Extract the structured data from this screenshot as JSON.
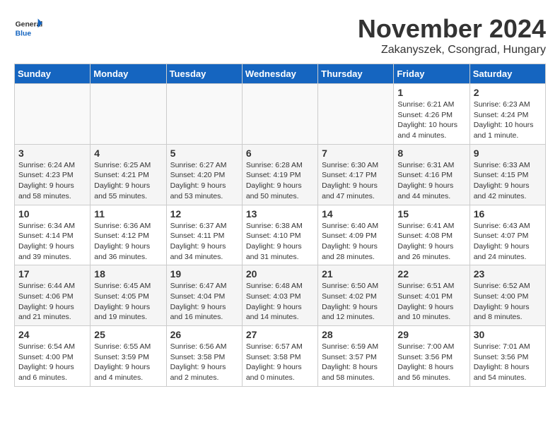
{
  "header": {
    "logo_general": "General",
    "logo_blue": "Blue",
    "month_title": "November 2024",
    "location": "Zakanyszek, Csongrad, Hungary"
  },
  "weekdays": [
    "Sunday",
    "Monday",
    "Tuesday",
    "Wednesday",
    "Thursday",
    "Friday",
    "Saturday"
  ],
  "weeks": [
    [
      {
        "day": "",
        "info": ""
      },
      {
        "day": "",
        "info": ""
      },
      {
        "day": "",
        "info": ""
      },
      {
        "day": "",
        "info": ""
      },
      {
        "day": "",
        "info": ""
      },
      {
        "day": "1",
        "info": "Sunrise: 6:21 AM\nSunset: 4:26 PM\nDaylight: 10 hours\nand 4 minutes."
      },
      {
        "day": "2",
        "info": "Sunrise: 6:23 AM\nSunset: 4:24 PM\nDaylight: 10 hours\nand 1 minute."
      }
    ],
    [
      {
        "day": "3",
        "info": "Sunrise: 6:24 AM\nSunset: 4:23 PM\nDaylight: 9 hours\nand 58 minutes."
      },
      {
        "day": "4",
        "info": "Sunrise: 6:25 AM\nSunset: 4:21 PM\nDaylight: 9 hours\nand 55 minutes."
      },
      {
        "day": "5",
        "info": "Sunrise: 6:27 AM\nSunset: 4:20 PM\nDaylight: 9 hours\nand 53 minutes."
      },
      {
        "day": "6",
        "info": "Sunrise: 6:28 AM\nSunset: 4:19 PM\nDaylight: 9 hours\nand 50 minutes."
      },
      {
        "day": "7",
        "info": "Sunrise: 6:30 AM\nSunset: 4:17 PM\nDaylight: 9 hours\nand 47 minutes."
      },
      {
        "day": "8",
        "info": "Sunrise: 6:31 AM\nSunset: 4:16 PM\nDaylight: 9 hours\nand 44 minutes."
      },
      {
        "day": "9",
        "info": "Sunrise: 6:33 AM\nSunset: 4:15 PM\nDaylight: 9 hours\nand 42 minutes."
      }
    ],
    [
      {
        "day": "10",
        "info": "Sunrise: 6:34 AM\nSunset: 4:14 PM\nDaylight: 9 hours\nand 39 minutes."
      },
      {
        "day": "11",
        "info": "Sunrise: 6:36 AM\nSunset: 4:12 PM\nDaylight: 9 hours\nand 36 minutes."
      },
      {
        "day": "12",
        "info": "Sunrise: 6:37 AM\nSunset: 4:11 PM\nDaylight: 9 hours\nand 34 minutes."
      },
      {
        "day": "13",
        "info": "Sunrise: 6:38 AM\nSunset: 4:10 PM\nDaylight: 9 hours\nand 31 minutes."
      },
      {
        "day": "14",
        "info": "Sunrise: 6:40 AM\nSunset: 4:09 PM\nDaylight: 9 hours\nand 28 minutes."
      },
      {
        "day": "15",
        "info": "Sunrise: 6:41 AM\nSunset: 4:08 PM\nDaylight: 9 hours\nand 26 minutes."
      },
      {
        "day": "16",
        "info": "Sunrise: 6:43 AM\nSunset: 4:07 PM\nDaylight: 9 hours\nand 24 minutes."
      }
    ],
    [
      {
        "day": "17",
        "info": "Sunrise: 6:44 AM\nSunset: 4:06 PM\nDaylight: 9 hours\nand 21 minutes."
      },
      {
        "day": "18",
        "info": "Sunrise: 6:45 AM\nSunset: 4:05 PM\nDaylight: 9 hours\nand 19 minutes."
      },
      {
        "day": "19",
        "info": "Sunrise: 6:47 AM\nSunset: 4:04 PM\nDaylight: 9 hours\nand 16 minutes."
      },
      {
        "day": "20",
        "info": "Sunrise: 6:48 AM\nSunset: 4:03 PM\nDaylight: 9 hours\nand 14 minutes."
      },
      {
        "day": "21",
        "info": "Sunrise: 6:50 AM\nSunset: 4:02 PM\nDaylight: 9 hours\nand 12 minutes."
      },
      {
        "day": "22",
        "info": "Sunrise: 6:51 AM\nSunset: 4:01 PM\nDaylight: 9 hours\nand 10 minutes."
      },
      {
        "day": "23",
        "info": "Sunrise: 6:52 AM\nSunset: 4:00 PM\nDaylight: 9 hours\nand 8 minutes."
      }
    ],
    [
      {
        "day": "24",
        "info": "Sunrise: 6:54 AM\nSunset: 4:00 PM\nDaylight: 9 hours\nand 6 minutes."
      },
      {
        "day": "25",
        "info": "Sunrise: 6:55 AM\nSunset: 3:59 PM\nDaylight: 9 hours\nand 4 minutes."
      },
      {
        "day": "26",
        "info": "Sunrise: 6:56 AM\nSunset: 3:58 PM\nDaylight: 9 hours\nand 2 minutes."
      },
      {
        "day": "27",
        "info": "Sunrise: 6:57 AM\nSunset: 3:58 PM\nDaylight: 9 hours\nand 0 minutes."
      },
      {
        "day": "28",
        "info": "Sunrise: 6:59 AM\nSunset: 3:57 PM\nDaylight: 8 hours\nand 58 minutes."
      },
      {
        "day": "29",
        "info": "Sunrise: 7:00 AM\nSunset: 3:56 PM\nDaylight: 8 hours\nand 56 minutes."
      },
      {
        "day": "30",
        "info": "Sunrise: 7:01 AM\nSunset: 3:56 PM\nDaylight: 8 hours\nand 54 minutes."
      }
    ]
  ]
}
